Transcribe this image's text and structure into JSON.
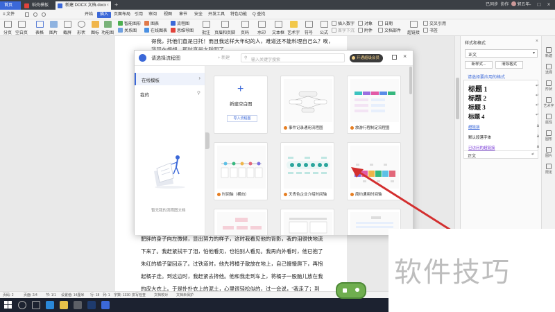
{
  "titlebar": {
    "tabs": [
      {
        "label": "首页"
      },
      {
        "label": "稻壳模板"
      },
      {
        "label": "新建 DOCX 文档.docx"
      }
    ],
    "add_tab": "+",
    "user_sync": "已同步",
    "user_share": "协作",
    "user_name": "郭五年"
  },
  "menubar": {
    "file": "≡ 文件",
    "items": [
      "开始",
      "插入",
      "页面布局",
      "引用",
      "审阅",
      "视图",
      "章节",
      "安全",
      "开发工具",
      "特色功能"
    ],
    "search": "Q 查找"
  },
  "toolbar": {
    "big": [
      "分页",
      "空白页",
      "表格",
      "图片",
      "截屏",
      "形状",
      "图标",
      "功能图"
    ],
    "smart_graphic": "智能图形",
    "chart": "图表",
    "online_chart": "在线图表",
    "relation_chart": "关系图",
    "flowchart": "流程图",
    "mindmap": "思维导图",
    "comment": "批注",
    "header_footer": "页眉和页脚",
    "page_number": "页码",
    "watermark": "水印",
    "textbox": "文本框",
    "wordart": "艺术字",
    "symbol": "符号",
    "formula": "公式",
    "insert_number": "插入数字",
    "first_letter": "首字下沉",
    "object": "对象",
    "attachment": "附件",
    "date": "日期",
    "doc_parts": "文档部件",
    "hyperlink": "超链接",
    "crossref": "交叉引用",
    "bookmark": "书签"
  },
  "document": {
    "line_top": "得我，托他们直是日托！而且我这样大年纪的人，难道还不能料理自己么？唉，",
    "line_top2": "我现在想想，那时真是太聪明了。",
    "lines": [
      "肥胖的身子向左微倾，显出努力的样子，这时我看见他的背影，我的泪很快地流",
      "下来了。我赶紧拭干了泪，怕他看见，也怕别人看见。我再向外看时，他已抱了",
      "朱红的橘子望回走了。过铁道时，他先将橘子散放在地上，自己慢慢爬下，再抱",
      "起橘子走。到这边时，我赶紧去搀他。他和我走到车上，将橘子一股脑儿放在我",
      "的皮大衣上。于是扑扑衣上的泥土，心里很轻松似的，过一会说，“我走了；到"
    ]
  },
  "dialog": {
    "title": "请选择流程图",
    "new_btn": "+ 新建",
    "search_placeholder": "输入关键字搜索",
    "vip": "开通超级会员",
    "sidebar": {
      "online_templates": "在线模板",
      "mine": "我的",
      "empty_note": "暂无我的流程图文档"
    },
    "blank": {
      "plus": "+",
      "title": "新建空白图",
      "import": "导入流程图"
    },
    "cards": [
      {
        "caption": "事件记录通用流程图"
      },
      {
        "caption": "旅游行程制定流程图"
      },
      {
        "caption": "时间轴（横向）"
      },
      {
        "caption": "天青色企业介绍时间轴"
      },
      {
        "caption": "简约通用时间轴"
      }
    ]
  },
  "rightpane": {
    "title": "样式和格式",
    "current_style": "正文",
    "new_style": "新样式...",
    "clear_format": "清除格式",
    "apply_label": "请选择要应用的格式",
    "styles": [
      "标题 1",
      "标题 2",
      "标题 3",
      "标题 4"
    ],
    "small_styles": [
      "超链接",
      "默认段落字体",
      "已访问的超链接"
    ],
    "body_style": "正文",
    "rail": [
      "新建",
      "选择",
      "形状",
      "艺术字",
      "属性",
      "图形",
      "图片",
      "限定"
    ]
  },
  "statusbar": {
    "page": "页码: 2",
    "pages": "页面: 2/4",
    "section": "节: 1/1",
    "setting": "设置值: 14厘米",
    "row": "行: 18",
    "col": "列: 1",
    "chars": "字数: 1330",
    "spell": "拼写检查",
    "compare": "文档校对",
    "protect": "文档未保护"
  },
  "watermark": {
    "text": "软件技巧"
  },
  "colors": {
    "accent": "#3b68d8",
    "orange": "#e67e22",
    "arrow": "#d32f2f"
  }
}
